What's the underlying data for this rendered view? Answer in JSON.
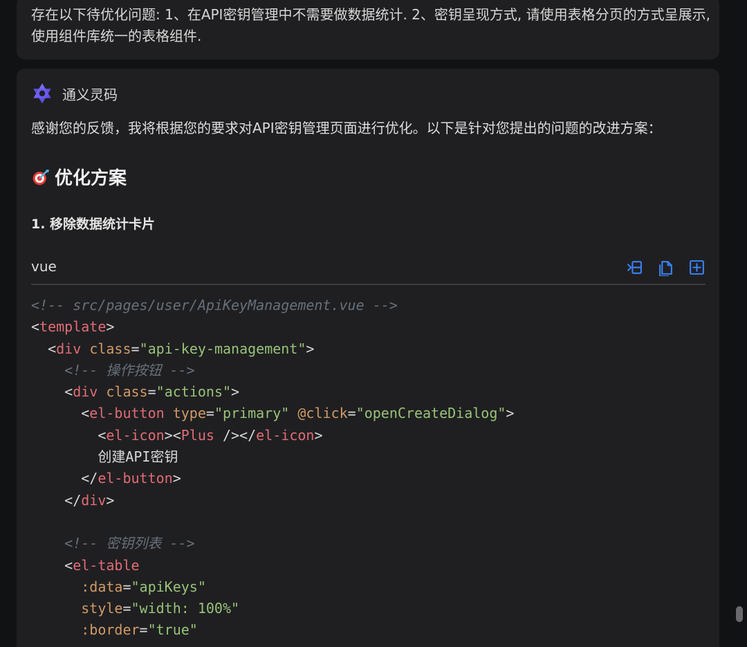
{
  "user_message": {
    "text": "存在以下待优化问题: 1、在API密钥管理中不需要做数据统计. 2、密钥呈现方式, 请使用表格分页的方式呈展示, 使用组件库统一的表格组件."
  },
  "assistant": {
    "name": "通义灵码",
    "intro": "感谢您的反馈，我将根据您的要求对API密钥管理页面进行优化。以下是针对您提出的问题的改进方案：",
    "heading": "优化方案",
    "step_1": "1. 移除数据统计卡片",
    "icons": {
      "logo": "tongyi-lingma-logo",
      "heading": "target-dart-icon"
    }
  },
  "code_block": {
    "language": "vue",
    "actions": [
      {
        "name": "insert-icon",
        "label": "insert"
      },
      {
        "name": "copy-icon",
        "label": "copy"
      },
      {
        "name": "new-file-icon",
        "label": "new file"
      }
    ],
    "lines": [
      [
        {
          "t": "<!-- src/pages/user/ApiKeyManagement.vue -->",
          "c": "comment"
        }
      ],
      [
        {
          "t": "<",
          "c": "punct"
        },
        {
          "t": "template",
          "c": "tag"
        },
        {
          "t": ">",
          "c": "punct"
        }
      ],
      [
        {
          "t": "  ",
          "c": "plain"
        },
        {
          "t": "<",
          "c": "punct"
        },
        {
          "t": "div",
          "c": "tag"
        },
        {
          "t": " ",
          "c": "plain"
        },
        {
          "t": "class",
          "c": "attr"
        },
        {
          "t": "=",
          "c": "punct"
        },
        {
          "t": "\"api-key-management\"",
          "c": "string"
        },
        {
          "t": ">",
          "c": "punct"
        }
      ],
      [
        {
          "t": "    <!-- 操作按钮 -->",
          "c": "comment"
        }
      ],
      [
        {
          "t": "    ",
          "c": "plain"
        },
        {
          "t": "<",
          "c": "punct"
        },
        {
          "t": "div",
          "c": "tag"
        },
        {
          "t": " ",
          "c": "plain"
        },
        {
          "t": "class",
          "c": "attr"
        },
        {
          "t": "=",
          "c": "punct"
        },
        {
          "t": "\"actions\"",
          "c": "string"
        },
        {
          "t": ">",
          "c": "punct"
        }
      ],
      [
        {
          "t": "      ",
          "c": "plain"
        },
        {
          "t": "<",
          "c": "punct"
        },
        {
          "t": "el-button",
          "c": "tag"
        },
        {
          "t": " ",
          "c": "plain"
        },
        {
          "t": "type",
          "c": "attr"
        },
        {
          "t": "=",
          "c": "punct"
        },
        {
          "t": "\"primary\"",
          "c": "string"
        },
        {
          "t": " ",
          "c": "plain"
        },
        {
          "t": "@click",
          "c": "attr"
        },
        {
          "t": "=",
          "c": "punct"
        },
        {
          "t": "\"openCreateDialog\"",
          "c": "string"
        },
        {
          "t": ">",
          "c": "punct"
        }
      ],
      [
        {
          "t": "        ",
          "c": "plain"
        },
        {
          "t": "<",
          "c": "punct"
        },
        {
          "t": "el-icon",
          "c": "tag"
        },
        {
          "t": "><",
          "c": "punct"
        },
        {
          "t": "Plus",
          "c": "tag"
        },
        {
          "t": " /></",
          "c": "punct"
        },
        {
          "t": "el-icon",
          "c": "tag"
        },
        {
          "t": ">",
          "c": "punct"
        }
      ],
      [
        {
          "t": "        创建API密钥",
          "c": "plain"
        }
      ],
      [
        {
          "t": "      ",
          "c": "plain"
        },
        {
          "t": "</",
          "c": "punct"
        },
        {
          "t": "el-button",
          "c": "tag"
        },
        {
          "t": ">",
          "c": "punct"
        }
      ],
      [
        {
          "t": "    ",
          "c": "plain"
        },
        {
          "t": "</",
          "c": "punct"
        },
        {
          "t": "div",
          "c": "tag"
        },
        {
          "t": ">",
          "c": "punct"
        }
      ],
      [
        {
          "t": "",
          "c": "plain"
        }
      ],
      [
        {
          "t": "    <!-- 密钥列表 -->",
          "c": "comment"
        }
      ],
      [
        {
          "t": "    ",
          "c": "plain"
        },
        {
          "t": "<",
          "c": "punct"
        },
        {
          "t": "el-table",
          "c": "tag"
        }
      ],
      [
        {
          "t": "      ",
          "c": "plain"
        },
        {
          "t": ":data",
          "c": "attr"
        },
        {
          "t": "=",
          "c": "punct"
        },
        {
          "t": "\"apiKeys\"",
          "c": "string"
        }
      ],
      [
        {
          "t": "      ",
          "c": "plain"
        },
        {
          "t": "style",
          "c": "attr"
        },
        {
          "t": "=",
          "c": "punct"
        },
        {
          "t": "\"width: 100%\"",
          "c": "string"
        }
      ],
      [
        {
          "t": "      ",
          "c": "plain"
        },
        {
          "t": ":border",
          "c": "attr"
        },
        {
          "t": "=",
          "c": "punct"
        },
        {
          "t": "\"true\"",
          "c": "string"
        }
      ]
    ]
  }
}
